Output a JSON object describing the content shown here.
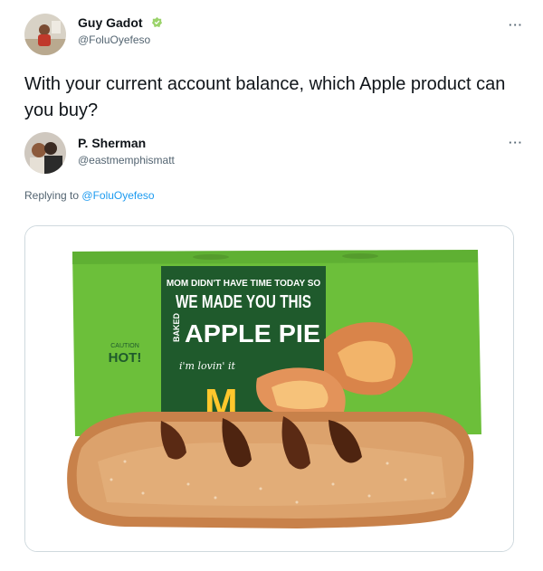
{
  "tweet": {
    "author_name": "Guy Gadot",
    "author_handle": "@FoluOyefeso",
    "more_icon": "more-icon",
    "text": "With your current account balance, which Apple product can you buy?"
  },
  "reply": {
    "author_name": "P. Sherman",
    "author_handle": "@eastmemphismatt",
    "replying_prefix": "Replying to",
    "replying_to": "@FoluOyefeso"
  },
  "media": {
    "box_text_line1": "MOM DIDN'T HAVE TIME TODAY SO",
    "box_text_line2": "WE MADE YOU THIS",
    "box_text_baked": "BAKED",
    "box_text_product": "APPLE PIE",
    "box_slogan": "i'm lovin' it",
    "box_caution": "CAUTION",
    "box_hot": "HOT!",
    "box_logo": "M"
  },
  "colors": {
    "box_green": "#6cbf3a",
    "box_dark_green": "#1f5a2c",
    "mcd_yellow": "#ffc72c",
    "link_blue": "#1d9bf0",
    "verified_badge": "#9bd36b"
  }
}
